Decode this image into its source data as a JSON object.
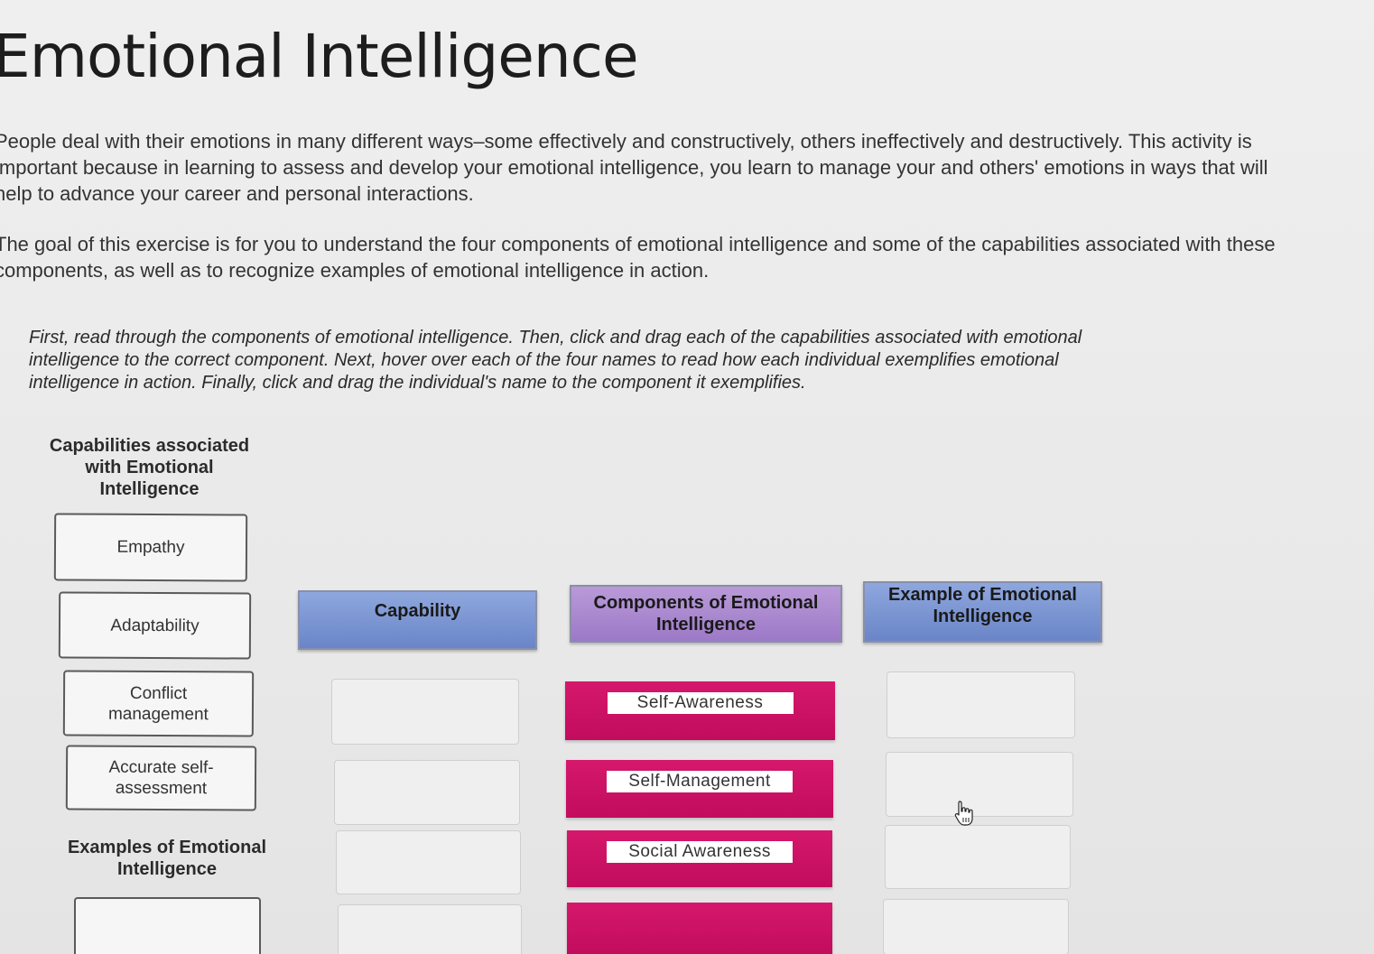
{
  "page": {
    "title": "Emotional Intelligence",
    "intro_paragraphs": [
      "People deal with their emotions in many different ways–some effectively and constructively, others ineffectively and destructively. This activity is important because in learning to assess and develop your emotional intelligence, you learn to manage your and others' emotions in ways that will help to advance your career and personal interactions.",
      "The goal of this exercise is for you to understand the four components of emotional intelligence and some of the capabilities associated with these components, as well as to recognize examples of emotional intelligence in action."
    ],
    "instructions": "First, read through the components of emotional intelligence. Then, click and drag each of the capabilities associated with emotional intelligence to the correct component. Next, hover over each of the four names to read how each individual exemplifies emotional intelligence in action. Finally, click and drag the individual's name to the component it exemplifies."
  },
  "capabilities_panel": {
    "heading": "Capabilities associated with Emotional Intelligence",
    "items": [
      "Empathy",
      "Adaptability",
      "Conflict management",
      "Accurate self-assessment"
    ]
  },
  "examples_panel": {
    "heading": "Examples of Emotional Intelligence"
  },
  "table": {
    "headers": {
      "capability": "Capability",
      "component": "Components of Emotional Intelligence",
      "example": "Example of Emotional Intelligence"
    },
    "components": [
      "Self-Awareness",
      "Self-Management",
      "Social Awareness"
    ]
  },
  "colors": {
    "header_blue": "#7b96d4",
    "header_purple": "#ab89cf",
    "component_magenta": "#cc1264"
  },
  "icons": {
    "cursor": "hand-pointer-icon"
  }
}
